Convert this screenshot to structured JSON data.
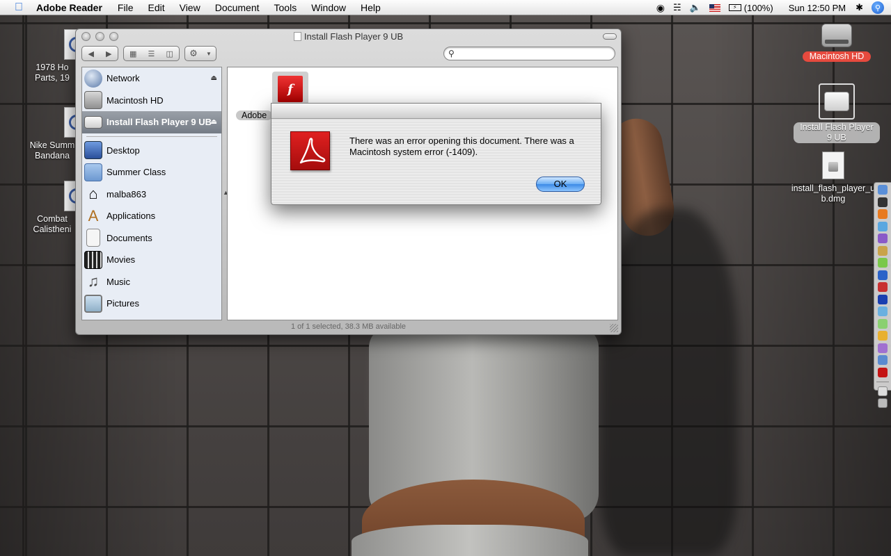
{
  "menubar": {
    "app": "Adobe Reader",
    "menus": [
      "File",
      "Edit",
      "View",
      "Document",
      "Tools",
      "Window",
      "Help"
    ],
    "battery": "(100%)",
    "clock": "Sun 12:50 PM"
  },
  "desktop": {
    "left_items": [
      {
        "label": "1978 Ho Parts, 19"
      },
      {
        "label": "Nike Summ Bandana"
      },
      {
        "label": "Combat Calistheni"
      }
    ],
    "macintosh_hd": "Macintosh HD",
    "install_volume": "Install Flash Player 9 UB",
    "dmg_file": "install_flash_player_ub.dmg"
  },
  "finder": {
    "title": "Install Flash Player 9 UB",
    "search_placeholder": "",
    "sidebar": {
      "devices": [
        {
          "label": "Network",
          "icon": "network-icon",
          "eject": true
        },
        {
          "label": "Macintosh HD",
          "icon": "hard-drive-icon",
          "eject": false
        },
        {
          "label": "Install Flash Player 9 UB",
          "icon": "disk-image-icon",
          "eject": true,
          "selected": true
        }
      ],
      "places": [
        {
          "label": "Desktop",
          "icon": "desktop-icon"
        },
        {
          "label": "Summer Class",
          "icon": "folder-icon"
        },
        {
          "label": "malba863",
          "icon": "home-icon"
        },
        {
          "label": "Applications",
          "icon": "applications-icon"
        },
        {
          "label": "Documents",
          "icon": "documents-icon"
        },
        {
          "label": "Movies",
          "icon": "movies-icon"
        },
        {
          "label": "Music",
          "icon": "music-icon"
        },
        {
          "label": "Pictures",
          "icon": "pictures-icon"
        }
      ]
    },
    "content_item_label": "Adobe",
    "status": "1 of 1 selected, 38.3 MB available"
  },
  "dialog": {
    "message": "There was an error opening this document. There was a Macintosh system error (-1409).",
    "ok_label": "OK"
  },
  "colors": {
    "menubar": "#e8e8e8",
    "hd_label": "#e64a3e",
    "acrobat_red": "#c41414",
    "aqua_button": "#5aa2f0"
  }
}
